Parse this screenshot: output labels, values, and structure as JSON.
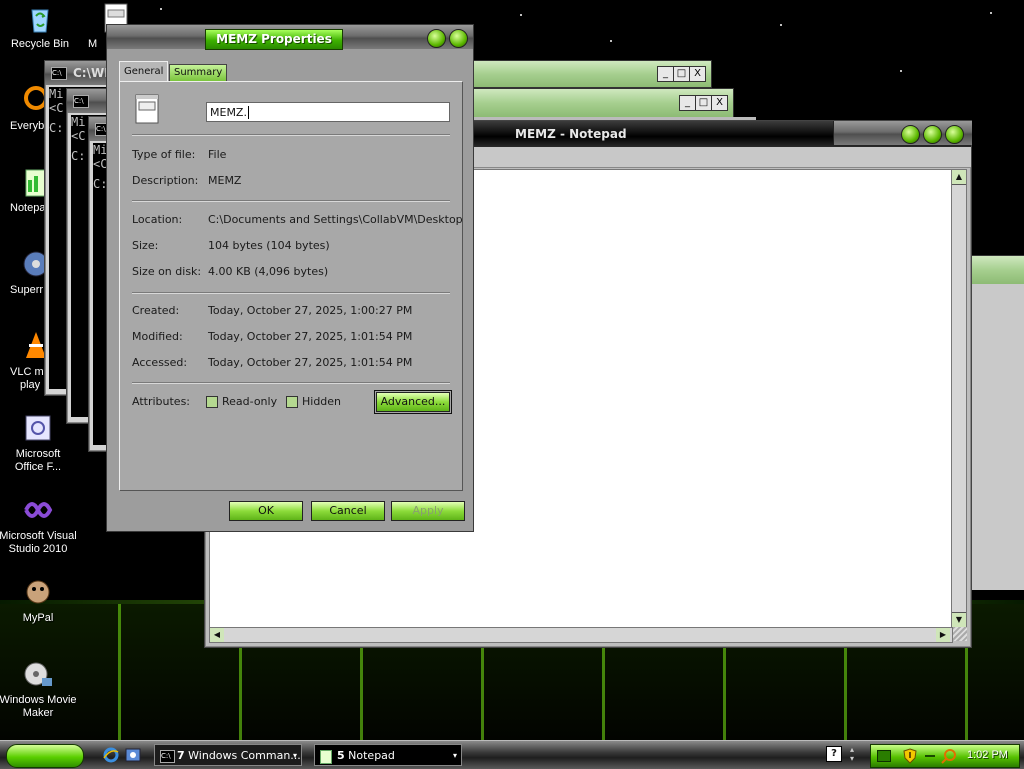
{
  "desktop_icons": [
    {
      "label": "Recycle Bin",
      "icon": "recycle-bin-icon"
    },
    {
      "label": "M",
      "icon": "text-file-icon"
    },
    {
      "label": "Everyb",
      "icon": "search-app-icon"
    },
    {
      "label": "Notepa",
      "icon": "notepad-app-icon"
    },
    {
      "label": "Superr",
      "icon": "disc-app-icon"
    },
    {
      "label": "VLC m",
      "label2": "play",
      "icon": "vlc-cone-icon"
    },
    {
      "label": "Microsoft",
      "label2": "Office F...",
      "icon": "office-app-icon"
    },
    {
      "label": "Microsoft Visual",
      "label2": "Studio 2010",
      "icon": "visual-studio-icon"
    },
    {
      "label": "MyPal",
      "icon": "mypal-browser-icon"
    },
    {
      "label": "Windows Movie",
      "label2": "Maker",
      "icon": "movie-maker-icon"
    }
  ],
  "console_windows": [
    {
      "title": "C:\\WI",
      "line1": "Mi",
      "line2": "<C",
      "line3": "C:"
    },
    {
      "title": "",
      "line1": "Mi",
      "line2": "<C",
      "line3": "C:"
    },
    {
      "title": "",
      "line1": "Mi",
      "line2": "<C",
      "line3": "C:"
    }
  ],
  "notepad": {
    "title": "MEMZ - Notepad"
  },
  "window_buttons": {
    "minimize": "_",
    "maximize": "□",
    "close": "X"
  },
  "properties": {
    "title": "MEMZ Properties",
    "tabs": [
      "General",
      "Summary"
    ],
    "filename": "MEMZ.",
    "file_icon": "text-file-icon",
    "rows_type": [
      {
        "label": "Type of file:",
        "value": "File"
      },
      {
        "label": "Description:",
        "value": "MEMZ"
      }
    ],
    "rows_loc": [
      {
        "label": "Location:",
        "value": "C:\\Documents and Settings\\CollabVM\\Desktop"
      },
      {
        "label": "Size:",
        "value": "104 bytes (104 bytes)"
      },
      {
        "label": "Size on disk:",
        "value": "4.00 KB (4,096 bytes)"
      }
    ],
    "rows_dates": [
      {
        "label": "Created:",
        "value": "Today, October 27, 2025, 1:00:27 PM"
      },
      {
        "label": "Modified:",
        "value": "Today, October 27, 2025, 1:01:54 PM"
      },
      {
        "label": "Accessed:",
        "value": "Today, October 27, 2025, 1:01:54 PM"
      }
    ],
    "attributes_label": "Attributes:",
    "readonly_label": "Read-only",
    "hidden_label": "Hidden",
    "readonly_checked": false,
    "hidden_checked": false,
    "advanced_label": "Advanced...",
    "ok_label": "OK",
    "cancel_label": "Cancel",
    "apply_label": "Apply"
  },
  "taskbar": {
    "tasks": [
      {
        "count": "7",
        "label": "Windows Comman...",
        "icon": "console-icon"
      },
      {
        "count": "5",
        "label": "Notepad",
        "icon": "notepad-icon"
      }
    ],
    "clock": "1:02 PM",
    "quicklaunch": [
      "internet-explorer-icon",
      "media-icon"
    ],
    "tray_icons": [
      "network-icon",
      "security-shield-icon",
      "volume-icon",
      "search-tray-icon"
    ]
  }
}
